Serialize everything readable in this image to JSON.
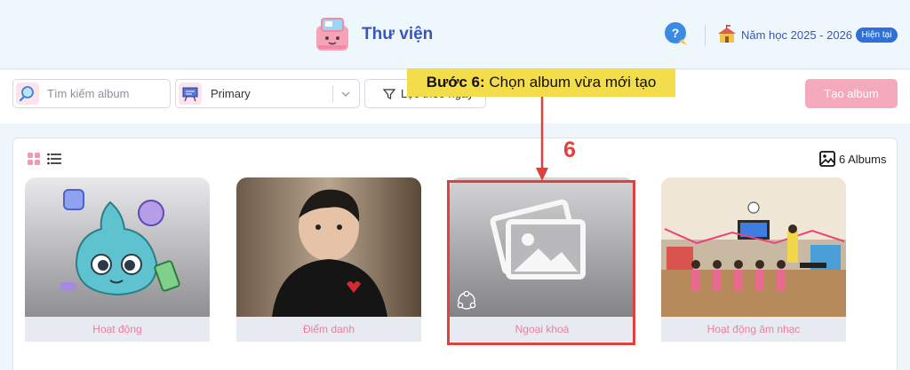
{
  "header": {
    "title": "Thư viện",
    "school_year": "Năm học 2025 - 2026",
    "current_badge": "Hiện tại"
  },
  "toolbar": {
    "search_placeholder": "Tìm kiếm album",
    "grade_value": "Primary",
    "filter_label": "Lọc theo ngày",
    "create_label": "Tạo album"
  },
  "panel": {
    "album_count": "6 Albums"
  },
  "albums": [
    {
      "label": "Hoạt động"
    },
    {
      "label": "Điểm danh"
    },
    {
      "label": "Ngoại khoá"
    },
    {
      "label": "Hoạt động âm nhạc"
    }
  ],
  "annotation": {
    "step_prefix": "Bước 6:",
    "step_text": " Chọn album vừa mới tạo",
    "step_number": "6"
  },
  "colors": {
    "accent": "#3a56b8",
    "pink": "#f4a9bd",
    "highlight": "#e0413e",
    "callout": "#f4dd4b"
  }
}
